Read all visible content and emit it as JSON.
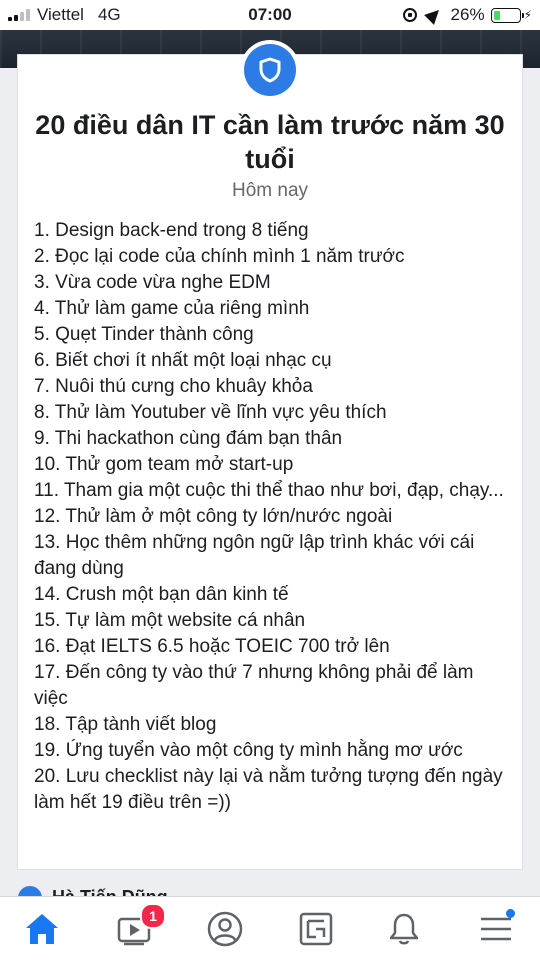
{
  "status_bar": {
    "carrier": "Viettel",
    "network": "4G",
    "time": "07:00",
    "battery": "26%",
    "battery_level": 0.26
  },
  "post": {
    "title": "20 điều dân IT cần làm trước năm 30 tuổi",
    "subtitle": "Hôm nay",
    "items": [
      "1. Design back-end trong 8 tiếng",
      "2. Đọc lại code của chính mình 1 năm trước",
      "3. Vừa code vừa nghe EDM",
      "4. Thử làm game của riêng mình",
      "5. Quẹt Tinder thành công",
      "6. Biết chơi ít nhất một loại nhạc cụ",
      "7. Nuôi thú cưng cho khuây khỏa",
      "8. Thử làm Youtuber về lĩnh vực yêu thích",
      "9. Thi hackathon cùng đám bạn thân",
      "10. Thử gom team mở start-up",
      "11. Tham gia một cuộc thi thể thao như bơi, đạp, chạy...",
      "12. Thử làm ở một công ty lớn/nước ngoài",
      "13. Học thêm những ngôn ngữ lập trình khác với cái đang dùng",
      "14. Crush một bạn dân kinh tế",
      "15. Tự làm một website cá nhân",
      "16. Đạt IELTS 6.5 hoặc TOEIC 700 trở lên",
      "17. Đến công ty vào thứ 7 nhưng không phải để làm việc",
      "18. Tập tành viết blog",
      "19. Ứng tuyển vào một công ty mình hằng mơ ước",
      "20. Lưu checklist này lại và nằm tưởng tượng đến ngày làm hết 19 điều trên =))"
    ]
  },
  "next_post": {
    "author_partial": "Hà Tiến Dũng"
  },
  "tab_bar": {
    "tabs": [
      {
        "icon": "home-icon",
        "active": true
      },
      {
        "icon": "video-icon",
        "badge": "1"
      },
      {
        "icon": "profile-icon"
      },
      {
        "icon": "marketplace-icon"
      },
      {
        "icon": "bell-icon"
      },
      {
        "icon": "menu-icon",
        "dot": true
      }
    ],
    "accent": "#1877f2",
    "badge_color": "#f02849"
  }
}
